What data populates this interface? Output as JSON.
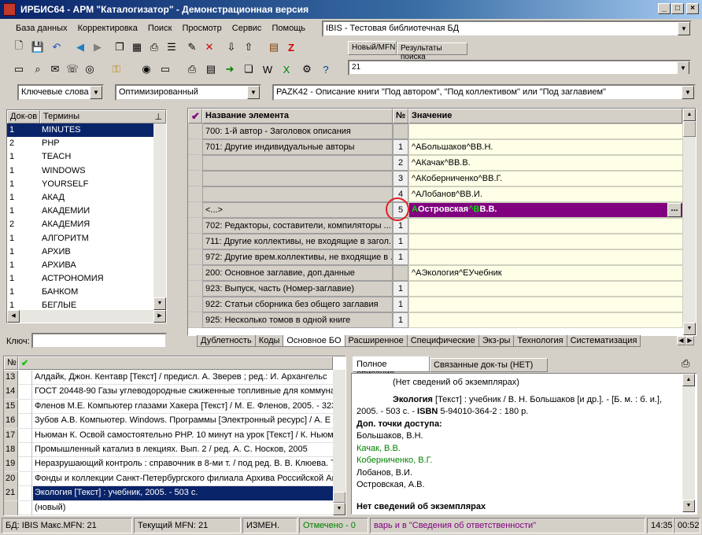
{
  "window": {
    "title": "ИРБИС64 - АРМ \"Каталогизатор\" - Демонстрационная версия",
    "buttons": [
      "_",
      "□",
      "×"
    ]
  },
  "menu": [
    "База данных",
    "Корректировка",
    "Поиск",
    "Просмотр",
    "Сервис",
    "Помощь"
  ],
  "db_combo": "IBIS - Тестовая библиотечная БД",
  "mfn_tabs": [
    "Новый/MFN",
    "Результаты поиска"
  ],
  "mfn_value": "21",
  "search": {
    "mode": "Ключевые слова",
    "method": "Оптимизированный",
    "worksheet": "PAZK42 - Описание книги \"Под автором\", \"Под коллективом\" или \"Под заглавием\""
  },
  "dictionary": {
    "col_docs": "Док-ов",
    "col_terms": "Термины",
    "rows": [
      {
        "n": "1",
        "term": "MINUTES"
      },
      {
        "n": "2",
        "term": "PHP"
      },
      {
        "n": "1",
        "term": "TEACH"
      },
      {
        "n": "1",
        "term": "WINDOWS"
      },
      {
        "n": "1",
        "term": "YOURSELF"
      },
      {
        "n": "1",
        "term": "АКАД"
      },
      {
        "n": "1",
        "term": "АКАДЕМИИ"
      },
      {
        "n": "2",
        "term": "АКАДЕМИЯ"
      },
      {
        "n": "1",
        "term": "АЛГОРИТМ"
      },
      {
        "n": "1",
        "term": "АРХИВ"
      },
      {
        "n": "1",
        "term": "АРХИВА"
      },
      {
        "n": "1",
        "term": "АСТРОНОМИЯ"
      },
      {
        "n": "1",
        "term": "БАНКОМ"
      },
      {
        "n": "1",
        "term": "БЕГЛЫЕ"
      }
    ],
    "key_label": "Ключ:"
  },
  "editor": {
    "col_name": "Название элемента",
    "col_num": "№",
    "col_value": "Значение",
    "rows": [
      {
        "name": "700: 1-й автор - Заголовок описания",
        "num": "",
        "value": ""
      },
      {
        "name": "701: Другие индивидуальные авторы",
        "num": "1",
        "value": "^AБольшаков^BВ.Н."
      },
      {
        "name": "",
        "num": "2",
        "value": "^AКачак^BВ.В."
      },
      {
        "name": "",
        "num": "3",
        "value": "^AКоберниченко^BВ.Г."
      },
      {
        "name": "",
        "num": "4",
        "value": "^AЛобанов^BВ.И."
      },
      {
        "name": "<...>",
        "num": "5",
        "value": ""
      },
      {
        "name": "702: Редакторы, составители, компиляторы ...",
        "num": "1",
        "value": ""
      },
      {
        "name": "711: Другие коллективы, не входящие в загол...",
        "num": "1",
        "value": ""
      },
      {
        "name": "972: Другие врем.коллективы, не входящие в ...",
        "num": "1",
        "value": ""
      },
      {
        "name": "200: Основное заглавие, доп.данные",
        "num": "",
        "value": "^AЭкология^EУчебник"
      },
      {
        "name": "923: Выпуск, часть (Номер-заглавие)",
        "num": "1",
        "value": ""
      },
      {
        "name": "922: Статьи сборника без общего заглавия",
        "num": "1",
        "value": ""
      },
      {
        "name": "925: Несколько томов в одной книге",
        "num": "1",
        "value": ""
      }
    ],
    "selected_value_parts": [
      "A",
      "Островская",
      "^B",
      "В.В."
    ],
    "ellipsis_button": "...",
    "tabs": [
      "Дублетность",
      "Коды",
      "Основное БО",
      "Расширенное",
      "Специфические",
      "Экз-ры",
      "Технология",
      "Систематизация"
    ]
  },
  "results": {
    "col_num": "№",
    "rows": [
      {
        "n": "13",
        "text": "Алдайк, Джон. Кентавр [Текст] / предисл. А. Зверев ; ред.: И. Архангельс"
      },
      {
        "n": "14",
        "text": "ГОСТ 20448-90 Газы углеводородные сжиженные топливные для коммуна"
      },
      {
        "n": "15",
        "text": "Фленов М.Е. Компьютер глазами Хакера [Текст] / М. Е. Фленов, 2005. - 323"
      },
      {
        "n": "16",
        "text": "Зубов А.В. Компьютер. Windows. Программы [Электронный ресурс] / А. Е"
      },
      {
        "n": "17",
        "text": "Ньюман К. Освой самостоятельно PHP. 10 минут на урок [Текст] / К. Ньюм"
      },
      {
        "n": "18",
        "text": "Промышленный катализ в лекциях. Вып. 2 / ред. А. С. Носков, 2005"
      },
      {
        "n": "19",
        "text": "Неразрушающий контроль : справочник в 8-ми т. / под ред. В. В. Клюева. Т"
      },
      {
        "n": "20",
        "text": "Фонды и коллекции Санкт-Петербургского филиала Архива Российской Ак"
      },
      {
        "n": "21",
        "text": "Экология [Текст] : учебник, 2005. - 503 с."
      },
      {
        "n": "",
        "text": "(новый)"
      }
    ]
  },
  "description": {
    "tabs": [
      "Полное описание",
      "Связанные док-ты (НЕТ)"
    ],
    "line_no_copies": "(Нет сведений об экземплярах)",
    "title_bold": "Экология",
    "title_rest": " [Текст] : учебник / В. Н. Большаков [и др.]. - [Б. м. : б. и.],",
    "line2_start": "2005. - 503 с. - ",
    "isbn_bold": "ISBN",
    "line2_end": " 5-94010-364-2 : 180 р.",
    "access_points_label": "Доп. точки доступа:",
    "access_points": [
      "Большаков, В.Н.",
      "Качак, В.В.",
      "Коберниченко, В.Г.",
      "Лобанов, В.И.",
      "Островская, А.В."
    ],
    "footer_bold": "Нет сведений об экземплярах"
  },
  "status": {
    "db": "БД: IBIS Макс.MFN: 21",
    "current": "Текущий MFN: 21",
    "changed": "ИЗМЕН.",
    "marked": "Отмечено - 0",
    "hint": "варь и в \"Сведения об ответственности\"",
    "time": "14:35",
    "timer": "00:52"
  },
  "colors": {
    "title_start": "#0a246a",
    "selection": "#0a246a",
    "value_bg": "#ffffe8",
    "purple_edit": "#800080",
    "green_marker": "#00c000",
    "red_circle": "#e02020",
    "link_green": "#008000",
    "status_green": "#008000",
    "status_purple": "#800080"
  }
}
